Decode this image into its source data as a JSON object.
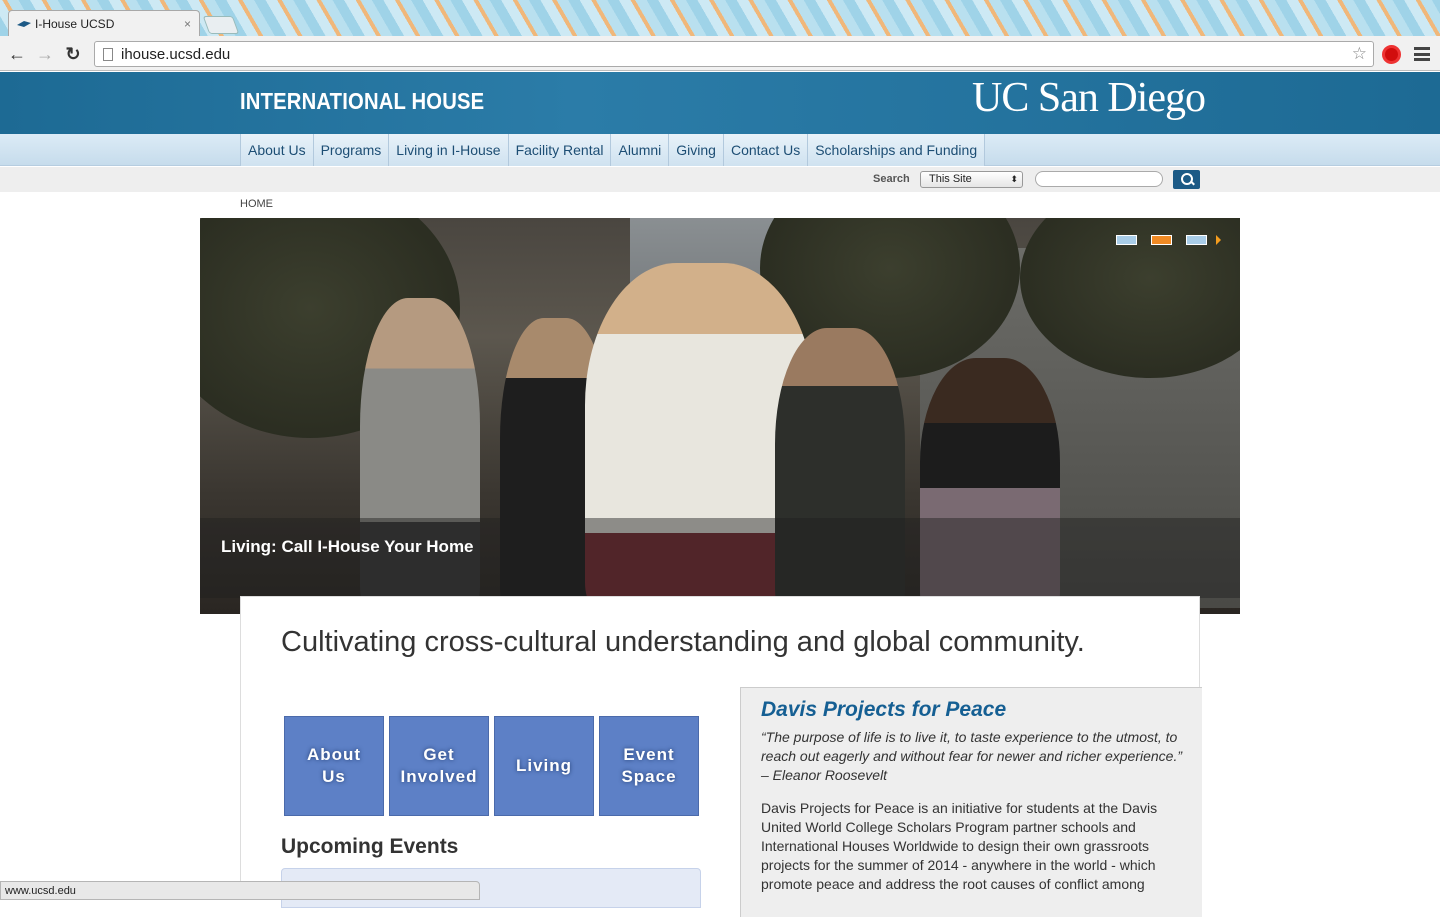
{
  "browser": {
    "tab_title": "I-House UCSD",
    "tab_close": "×",
    "url": "ihouse.ucsd.edu",
    "status_url": "www.ucsd.edu",
    "back_icon": "←",
    "forward_icon": "→",
    "reload_icon": "↻",
    "star_icon": "☆"
  },
  "header": {
    "site_title": "INTERNATIONAL HOUSE",
    "logo_text": "UC San Diego"
  },
  "nav": {
    "items": [
      {
        "label": "About Us"
      },
      {
        "label": "Programs"
      },
      {
        "label": "Living in I-House"
      },
      {
        "label": "Facility Rental"
      },
      {
        "label": "Alumni"
      },
      {
        "label": "Giving"
      },
      {
        "label": "Contact Us"
      },
      {
        "label": "Scholarships and Funding"
      }
    ]
  },
  "search": {
    "label": "Search",
    "scope_selected": "This Site",
    "select_arrow": "⬍",
    "query": ""
  },
  "breadcrumb": "HOME",
  "hero": {
    "caption": "Living: Call I-House Your Home",
    "slides": [
      {
        "color": "#a9cde8"
      },
      {
        "color": "#f08a24"
      },
      {
        "color": "#a9cde8"
      }
    ]
  },
  "main": {
    "tagline": "Cultivating cross-cultural understanding and global community.",
    "tiles": [
      {
        "line1": "About",
        "line2": "Us"
      },
      {
        "line1": "Get",
        "line2": "Involved"
      },
      {
        "line1": "Living",
        "line2": ""
      },
      {
        "line1": "Event",
        "line2": "Space"
      }
    ],
    "events_heading": "Upcoming Events"
  },
  "sidebar": {
    "title": "Davis Projects for Peace",
    "quote": "“The purpose of life is to live it, to taste experience to the utmost, to reach out eagerly and without fear for newer and richer experience.” – Eleanor Roosevelt",
    "body": "Davis Projects for Peace is an initiative for students at the Davis United World College Scholars Program partner schools and International Houses Worldwide to design their own grassroots projects for the summer of 2014 - anywhere in the world - which promote peace and address the root causes of conflict among"
  },
  "colors": {
    "header_blue": "#1d6a94",
    "link_blue": "#155f93",
    "tile_blue": "#5d80c6",
    "slide_active": "#f08a24"
  }
}
